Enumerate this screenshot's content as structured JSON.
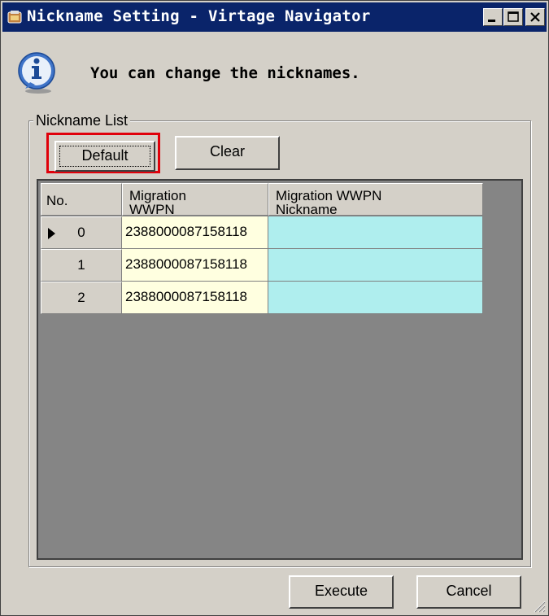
{
  "window": {
    "title": "Nickname Setting - Virtage Navigator",
    "title_icon": "app-icon",
    "controls": [
      "minimize-icon",
      "maximize-icon",
      "close-icon"
    ]
  },
  "info": {
    "icon": "info-icon",
    "message": "You can change the nicknames."
  },
  "group": {
    "label": "Nickname List",
    "default_label": "Default",
    "clear_label": "Clear"
  },
  "grid": {
    "columns": [
      "No.",
      "Migration\nWWPN",
      "Migration WWPN\nNickname"
    ],
    "rows": [
      {
        "no": "0",
        "wwpn": "2388000087158118",
        "nickname": "",
        "current": true
      },
      {
        "no": "1",
        "wwpn": "2388000087158118",
        "nickname": "",
        "current": false
      },
      {
        "no": "2",
        "wwpn": "2388000087158118",
        "nickname": "",
        "current": false
      }
    ]
  },
  "footer": {
    "execute_label": "Execute",
    "cancel_label": "Cancel"
  },
  "colors": {
    "titlebar": "#0a246a",
    "wwpn_cell": "#ffffe0",
    "nickname_cell": "#afeeee",
    "highlight": "#e0000a",
    "grid_bg": "#858585"
  }
}
